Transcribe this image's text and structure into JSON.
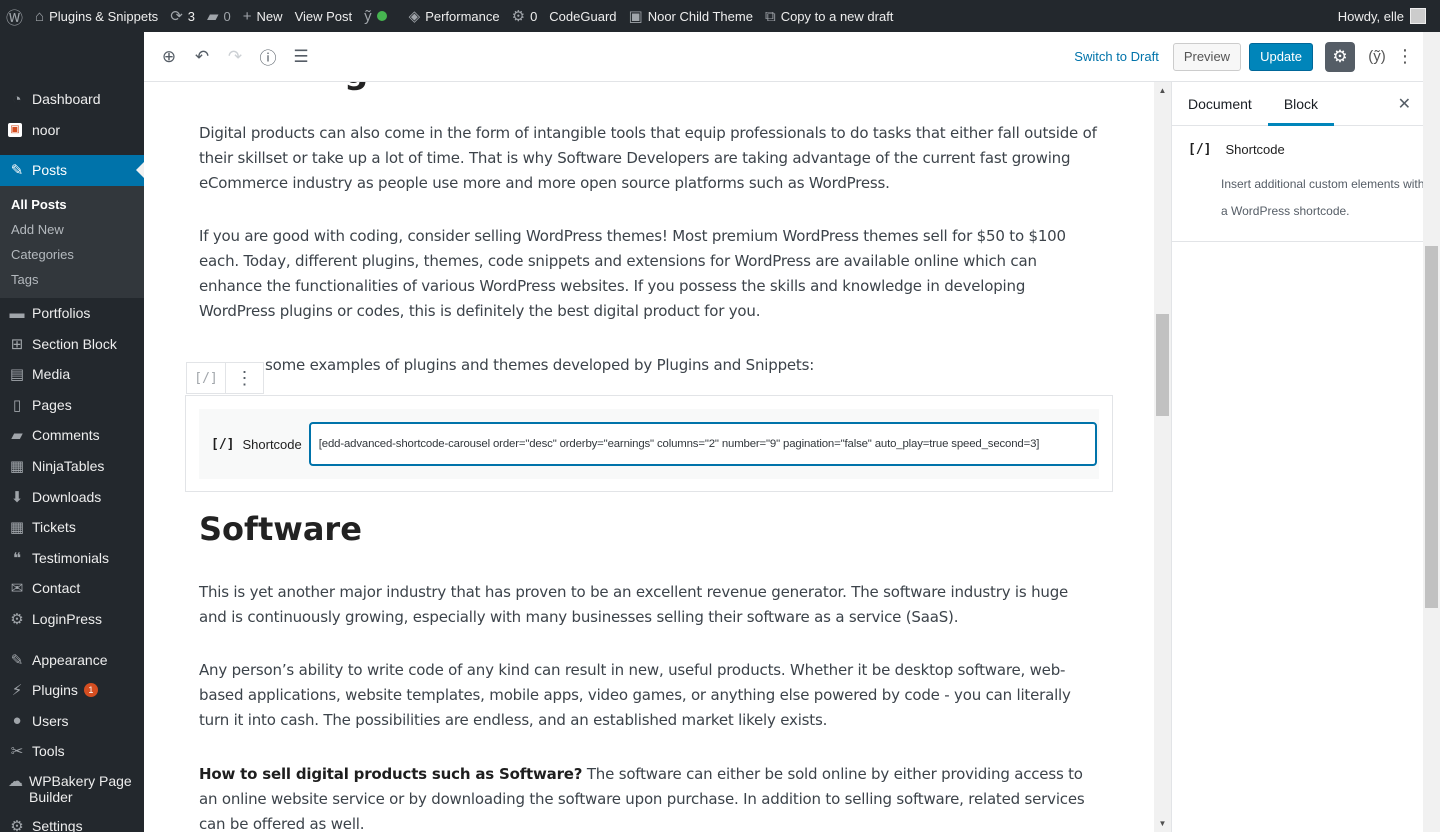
{
  "adminbar": {
    "site_name": "Plugins & Snippets",
    "updates_count": "3",
    "comments_count": "0",
    "new_label": "New",
    "view_post_label": "View Post",
    "performance_label": "Performance",
    "cache_count": "0",
    "codeguard_label": "CodeGuard",
    "theme_label": "Noor Child Theme",
    "copy_label": "Copy to a new draft",
    "howdy": "Howdy, elle"
  },
  "menu": {
    "items_top": [
      {
        "label": "Dashboard",
        "icon": "dashboard-icon"
      },
      {
        "label": "noor",
        "icon": "noor-icon"
      }
    ],
    "current": {
      "label": "Posts",
      "icon": "pin-icon"
    },
    "submenu": [
      "All Posts",
      "Add New",
      "Categories",
      "Tags"
    ],
    "items_mid": [
      {
        "label": "Portfolios",
        "icon": "folder-icon"
      },
      {
        "label": "Section Block",
        "icon": "grid-icon"
      },
      {
        "label": "Media",
        "icon": "media-icon"
      },
      {
        "label": "Pages",
        "icon": "pages-icon"
      },
      {
        "label": "Comments",
        "icon": "comment-icon"
      },
      {
        "label": "NinjaTables",
        "icon": "table-icon"
      },
      {
        "label": "Downloads",
        "icon": "download-icon"
      },
      {
        "label": "Tickets",
        "icon": "tickets-icon"
      },
      {
        "label": "Testimonials",
        "icon": "quote-icon"
      },
      {
        "label": "Contact",
        "icon": "mail-icon"
      },
      {
        "label": "LoginPress",
        "icon": "gear-icon"
      }
    ],
    "items_bottom": [
      {
        "label": "Appearance",
        "icon": "brush-icon"
      },
      {
        "label": "Plugins",
        "icon": "plugin-icon",
        "badge": "1"
      },
      {
        "label": "Users",
        "icon": "user-icon"
      },
      {
        "label": "Tools",
        "icon": "wrench-icon"
      },
      {
        "label": "WPBakery Page Builder",
        "icon": "wpbakery-icon"
      },
      {
        "label": "Settings",
        "icon": "settings-icon"
      }
    ]
  },
  "header": {
    "switch_draft": "Switch to Draft",
    "preview": "Preview",
    "update": "Update"
  },
  "content": {
    "p1": "Digital products can also come in the form of intangible tools that equip professionals to do tasks that either fall outside of their skillset or take up a lot of time. That is why Software Developers are taking advantage of the current fast growing eCommerce industry as people use more and more open source platforms such as WordPress.",
    "p2": "If you are good with coding, consider selling WordPress themes! Most premium WordPress themes sell for $50 to $100 each. Today, different plugins, themes, code snippets and extensions for WordPress are available online which can enhance the functionalities of various WordPress websites. If you possess the skills and knowledge in developing WordPress plugins or codes, this is definitely the best digital product for you.",
    "p3": "some examples of plugins and themes developed by Plugins and Snippets:",
    "shortcode_label": "Shortcode",
    "shortcode_value": "[edd-advanced-shortcode-carousel order=\"desc\" orderby=\"earnings\" columns=\"2\" number=\"9\" pagination=\"false\" auto_play=true speed_second=3]",
    "heading": "Software",
    "p4": "This is yet another major industry that has proven to be an excellent revenue generator. The software industry is huge and is continuously growing, especially with many businesses selling their software as a service (SaaS).",
    "p5": "Any person’s ability to write code of any kind can result in new, useful products. Whether it be desktop software, web-based applications, website templates, mobile apps, video games, or anything else powered by code - you can literally turn it into cash. The possibilities are endless, and an established market likely exists.",
    "p6_bold": "How to sell digital products such as Software?",
    "p6": " The software can either be sold online by either providing access to an online website service or by downloading the software upon purchase. In addition to selling software, related services can be offered as well."
  },
  "sidebar": {
    "tab_document": "Document",
    "tab_block": "Block",
    "block_title": "Shortcode",
    "block_desc": "Insert additional custom elements with a WordPress shortcode."
  }
}
